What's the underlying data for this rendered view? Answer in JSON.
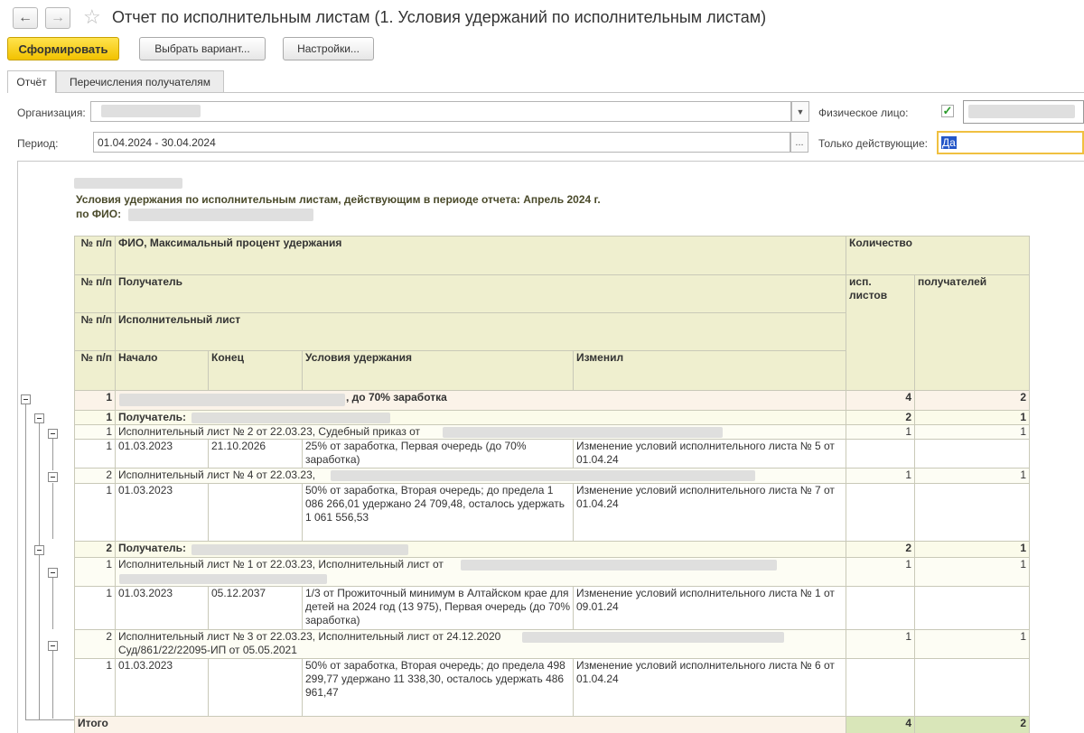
{
  "window": {
    "title": "Отчет по исполнительным листам (1. Условия удержаний по исполнительным листам)"
  },
  "toolbar": {
    "generate": "Сформировать",
    "choose_variant": "Выбрать вариант...",
    "settings": "Настройки..."
  },
  "tabs": [
    {
      "label": "Отчёт",
      "active": true
    },
    {
      "label": "Перечисления получателям",
      "active": false
    }
  ],
  "form": {
    "organization_label": "Организация:",
    "organization_value": "",
    "person_label": "Физическое лицо:",
    "person_checked": true,
    "period_label": "Период:",
    "period_value": "01.04.2024 - 30.04.2024",
    "only_active_label": "Только действующие:",
    "only_active_value": "Да"
  },
  "report": {
    "heading": "Условия удержания по исполнительным листам, действующим в периоде отчета: Апрель 2024 г.",
    "fio_label": "по ФИО:",
    "header": {
      "num": "№ п/п",
      "fio": "ФИО, Максимальный процент удержания",
      "count": "Количество",
      "recipient": "Получатель",
      "exec_sheets": "исп. листов",
      "recipients": "получателей",
      "exec_list": "Исполнительный лист",
      "start": "Начало",
      "end": "Конец",
      "conditions": "Условия удержания",
      "changed": "Изменил"
    },
    "rows": {
      "r1": {
        "n": "1",
        "text": ", до 70% заработка",
        "c1": "4",
        "c2": "2"
      },
      "r1_1": {
        "n": "1",
        "text": "Получатель:",
        "c1": "2",
        "c2": "1"
      },
      "r1_1_1": {
        "n": "1",
        "text": "Исполнительный лист № 2 от 22.03.23, Судебный приказ от",
        "c1": "1",
        "c2": "1"
      },
      "d1": {
        "n": "1",
        "start": "01.03.2023",
        "end": "21.10.2026",
        "cond": "25% от заработка, Первая очередь (до 70% заработка)",
        "changed": "Изменение условий исполнительного листа № 5 от 01.04.24"
      },
      "r1_1_2": {
        "n": "2",
        "text": "Исполнительный лист № 4 от 22.03.23,",
        "c1": "1",
        "c2": "1"
      },
      "d2": {
        "n": "1",
        "start": "01.03.2023",
        "end": "",
        "cond": "50% от заработка, Вторая очередь; до предела 1 086 266,01 удержано 24 709,48, осталось удержать 1 061 556,53",
        "changed": "Изменение условий исполнительного листа № 7 от 01.04.24"
      },
      "r1_2": {
        "n": "2",
        "text": "Получатель:",
        "c1": "2",
        "c2": "1"
      },
      "r1_2_1": {
        "n": "1",
        "text": "Исполнительный лист № 1 от 22.03.23, Исполнительный лист от",
        "c1": "1",
        "c2": "1"
      },
      "d3": {
        "n": "1",
        "start": "01.03.2023",
        "end": "05.12.2037",
        "cond": "1/3 от Прожиточный минимум в Алтайском крае для детей на 2024 год (13 975), Первая очередь (до 70% заработка)",
        "changed": "Изменение условий исполнительного листа № 1 от 09.01.24"
      },
      "r1_2_2": {
        "n": "2",
        "text": "Исполнительный лист № 3 от 22.03.23, Исполнительный лист от 24.12.2020",
        "text2": "Суд/861/22/22095-ИП от 05.05.2021",
        "c1": "1",
        "c2": "1"
      },
      "d4": {
        "n": "1",
        "start": "01.03.2023",
        "end": "",
        "cond": "50% от заработка, Вторая очередь; до предела 498 299,77 удержано 11 338,30, осталось удержать 486 961,47",
        "changed": "Изменение условий исполнительного листа № 6 от 01.04.24"
      },
      "total": {
        "text": "Итого",
        "c1": "4",
        "c2": "2"
      }
    }
  }
}
